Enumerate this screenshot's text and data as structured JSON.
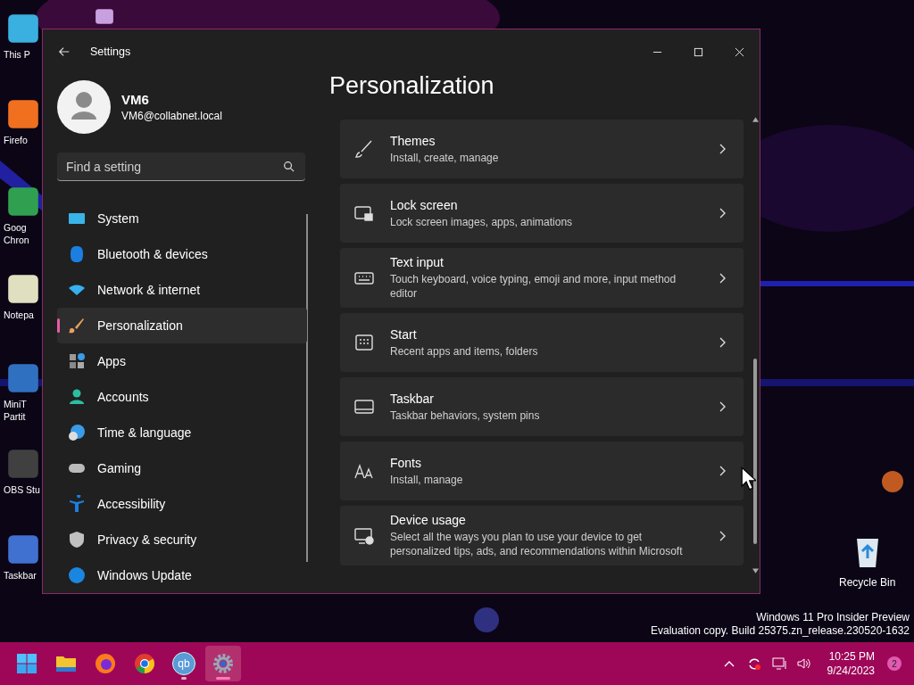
{
  "desktop": {
    "icons": [
      {
        "lines": [
          "This P"
        ]
      },
      {
        "lines": [
          "Firefo"
        ]
      },
      {
        "lines": [
          "Goog",
          "Chron"
        ]
      },
      {
        "lines": [
          "Notepa"
        ]
      },
      {
        "lines": [
          "MiniT",
          "Partit"
        ]
      },
      {
        "lines": [
          "OBS Stu"
        ]
      },
      {
        "lines": [
          "Taskbar"
        ]
      }
    ],
    "recycle_bin": "Recycle Bin",
    "watermark": [
      "Windows 11 Pro Insider Preview",
      "Evaluation copy. Build 25375.zn_release.230520-1632"
    ]
  },
  "window": {
    "title": "Settings",
    "user": {
      "name": "VM6",
      "email": "VM6@collabnet.local"
    },
    "search": {
      "placeholder": "Find a setting"
    },
    "nav": [
      {
        "label": "System",
        "selected": false
      },
      {
        "label": "Bluetooth & devices",
        "selected": false
      },
      {
        "label": "Network & internet",
        "selected": false
      },
      {
        "label": "Personalization",
        "selected": true
      },
      {
        "label": "Apps",
        "selected": false
      },
      {
        "label": "Accounts",
        "selected": false
      },
      {
        "label": "Time & language",
        "selected": false
      },
      {
        "label": "Gaming",
        "selected": false
      },
      {
        "label": "Accessibility",
        "selected": false
      },
      {
        "label": "Privacy & security",
        "selected": false
      },
      {
        "label": "Windows Update",
        "selected": false
      }
    ],
    "page_title": "Personalization",
    "cards": [
      {
        "title": "Themes",
        "subtitle": "Install, create, manage"
      },
      {
        "title": "Lock screen",
        "subtitle": "Lock screen images, apps, animations"
      },
      {
        "title": "Text input",
        "subtitle": "Touch keyboard, voice typing, emoji and more, input method editor"
      },
      {
        "title": "Start",
        "subtitle": "Recent apps and items, folders"
      },
      {
        "title": "Taskbar",
        "subtitle": "Taskbar behaviors, system pins"
      },
      {
        "title": "Fonts",
        "subtitle": "Install, manage"
      },
      {
        "title": "Device usage",
        "subtitle": "Select all the ways you plan to use your device to get personalized tips, ads, and recommendations within Microsoft"
      }
    ]
  },
  "taskbar": {
    "apps": [
      {
        "kind": "start",
        "running": false,
        "selected": false
      },
      {
        "kind": "folder",
        "running": false,
        "selected": false
      },
      {
        "kind": "firefox",
        "running": false,
        "selected": false
      },
      {
        "kind": "chrome",
        "running": false,
        "selected": false
      },
      {
        "kind": "qb",
        "glyph": "qb",
        "running": true,
        "selected": false
      },
      {
        "kind": "settings",
        "running": true,
        "selected": true
      }
    ],
    "time": "10:25 PM",
    "date": "9/24/2023",
    "badge": "2"
  }
}
